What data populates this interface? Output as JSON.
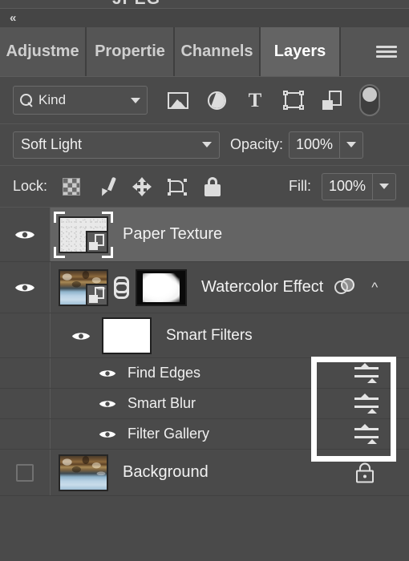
{
  "window": {
    "clipped_top_text": "JPEG",
    "collapse_icon": "double-chevron-left-icon",
    "panel_bg": "#4a4a4a",
    "accent_highlight": "#646464"
  },
  "tabs": {
    "items": [
      {
        "label": "Adjustme",
        "active": false
      },
      {
        "label": "Propertie",
        "active": false
      },
      {
        "label": "Channels",
        "active": false
      },
      {
        "label": "Layers",
        "active": true
      }
    ],
    "menu_icon": "hamburger-menu-icon"
  },
  "filter_bar": {
    "search_icon": "search-icon",
    "kind_label": "Kind",
    "kind_caret": "chevron-down-icon",
    "type_filters": [
      {
        "name": "pixel-layers-filter-icon"
      },
      {
        "name": "adjustment-layers-filter-icon"
      },
      {
        "name": "type-layers-filter-icon"
      },
      {
        "name": "shape-layers-filter-icon"
      },
      {
        "name": "smart-object-filter-icon"
      }
    ],
    "toggle_icon": "filter-toggle-switch"
  },
  "blend_bar": {
    "blend_mode": "Soft Light",
    "blend_caret": "chevron-down-icon",
    "opacity_label": "Opacity:",
    "opacity_value": "100%",
    "opacity_caret": "chevron-down-icon"
  },
  "lock_bar": {
    "lock_label": "Lock:",
    "lock_icons": [
      {
        "name": "lock-transparent-pixels-icon"
      },
      {
        "name": "lock-image-pixels-brush-icon"
      },
      {
        "name": "lock-position-move-icon"
      },
      {
        "name": "lock-artboard-nesting-icon"
      },
      {
        "name": "lock-all-padlock-icon"
      }
    ],
    "fill_label": "Fill:",
    "fill_value": "100%",
    "fill_caret": "chevron-down-icon"
  },
  "layers": [
    {
      "name": "Paper Texture",
      "visible": true,
      "selected": true,
      "thumb": "paper-texture-thumbnail",
      "smart_object": true,
      "has_mask": false
    },
    {
      "name": "Watercolor Effect",
      "visible": true,
      "selected": false,
      "thumb": "landscape-photo-thumbnail",
      "smart_object": true,
      "has_mask": true,
      "link_icon": "mask-link-icon",
      "smart_filter_indicator": "smart-filter-icon",
      "expand_chevron": "chevron-up-icon"
    }
  ],
  "smart_filters": {
    "label": "Smart Filters",
    "visible": true,
    "mask_thumb": "smart-filter-mask-white",
    "items": [
      {
        "label": "Find Edges",
        "visible": true,
        "blend_options_icon": "blending-options-icon"
      },
      {
        "label": "Smart Blur",
        "visible": true,
        "blend_options_icon": "blending-options-icon"
      },
      {
        "label": "Filter Gallery",
        "visible": true,
        "blend_options_icon": "blending-options-icon"
      }
    ]
  },
  "background_layer": {
    "name": "Background",
    "visible": false,
    "thumb": "landscape-photo-thumbnail",
    "lock_icon": "locked-padlock-icon"
  },
  "annotation": {
    "type": "highlight-rectangle",
    "color": "#ffffff",
    "targets": "blending-options-icons-column"
  }
}
